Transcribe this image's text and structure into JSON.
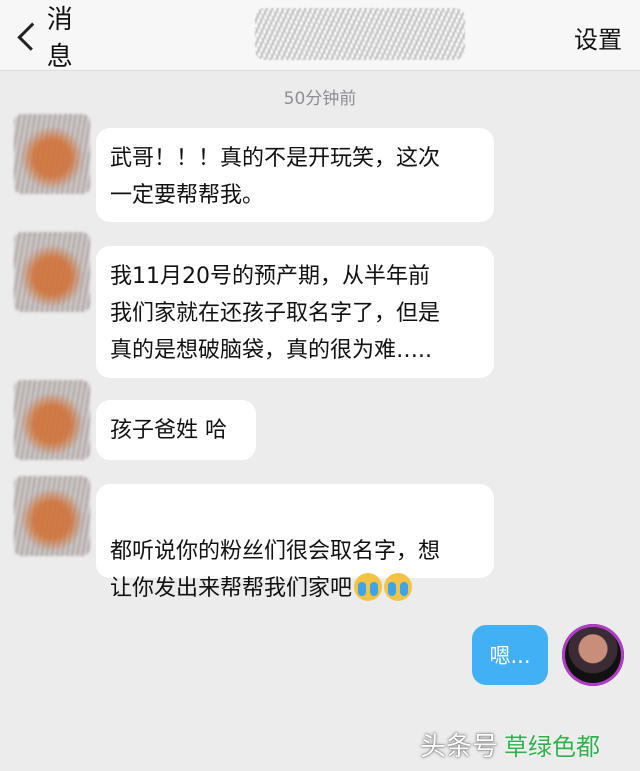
{
  "header": {
    "back_label": "消息",
    "settings_label": "设置"
  },
  "timestamp": "50分钟前",
  "messages": [
    {
      "text": "武哥！！！真的不是开玩笑，这次\n一定要帮帮我。"
    },
    {
      "text": "我11月20号的预产期，从半年前\n我们家就在还孩子取名字了，但是\n真的是想破脑袋，真的很为难….."
    },
    {
      "text": "孩子爸姓 哈"
    },
    {
      "text": "都听说你的粉丝们很会取名字，想\n让你发出来帮帮我们家吧"
    }
  ],
  "sent_message": {
    "text": "嗯..."
  },
  "watermark": {
    "main": "头条号",
    "green": "草绿色都"
  }
}
